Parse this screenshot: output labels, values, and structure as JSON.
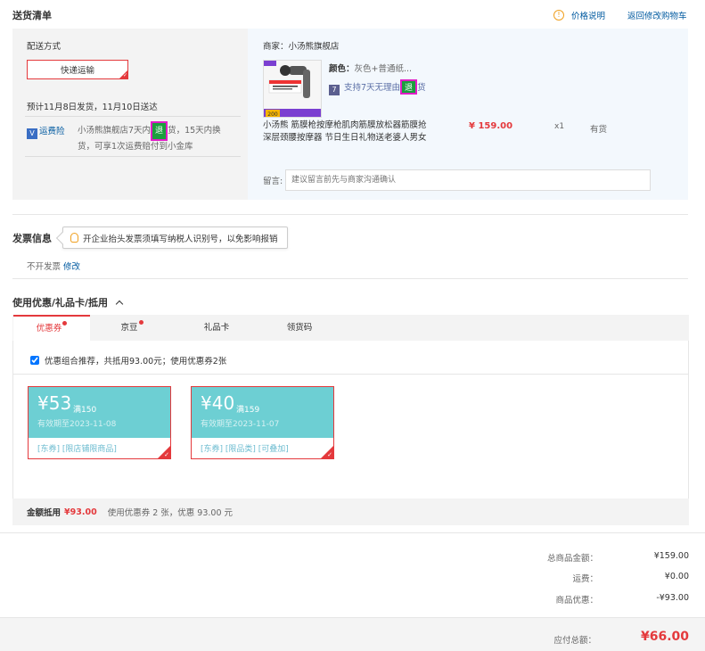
{
  "shipping": {
    "title": "送货清单",
    "price_note": "价格说明",
    "back_cart": "返回修改购物车",
    "method_label": "配送方式",
    "method_value": "快递运输",
    "schedule": "预计11月8日发货，11月10日送达",
    "insurance_label": "运费险",
    "insurance_text_a": "小汤熊旗舰店7天内",
    "return_word": "退",
    "insurance_text_b": "货，15天内换",
    "insurance_text_c": "货，可享1次运费赔付到小金库"
  },
  "product": {
    "merchant": "商家：小汤熊旗舰店",
    "color_label": "颜色：",
    "color_value": "灰色+普通纸...",
    "return_policy_a": "支持7天无理由",
    "return_policy_b": "货",
    "name_line1": "小汤熊 筋膜枪按摩枪肌肉筋膜放松器筋膜抢",
    "name_line2": "深层颈腰按摩器 节日生日礼物送老婆人男女",
    "price": "¥ 159.00",
    "quantity": "x1",
    "stock": "有货",
    "img_badge": "200",
    "remark_label": "留言:",
    "remark_placeholder": "建议留言前先与商家沟通确认"
  },
  "invoice": {
    "title": "发票信息",
    "tip": "开企业抬头发票须填写纳税人识别号，以免影响报销",
    "status": "不开发票",
    "edit": "修改"
  },
  "discount": {
    "title": "使用优惠/礼品卡/抵用",
    "tabs": [
      {
        "label": "优惠券",
        "dot": true
      },
      {
        "label": "京豆",
        "dot": true
      },
      {
        "label": "礼品卡",
        "dot": false
      },
      {
        "label": "领货码",
        "dot": false
      }
    ],
    "combo_text": "优惠组合推荐，共抵用93.00元；使用优惠券2张",
    "coupons": [
      {
        "amount": "¥53",
        "condition": "满150",
        "expiry": "有效期至2023-11-08",
        "tags": "[东券]  [限店铺限商品]"
      },
      {
        "amount": "¥40",
        "condition": "满159",
        "expiry": "有效期至2023-11-07",
        "tags": "[东券]  [限品类]  [可叠加]"
      }
    ],
    "summary_label": "金额抵用",
    "summary_amount": "¥93.00",
    "summary_text": "使用优惠券 2 张，优惠 93.00 元"
  },
  "totals": {
    "goods_label": "总商品金额：",
    "goods_value": "¥159.00",
    "freight_label": "运费：",
    "freight_value": "¥0.00",
    "promo_label": "商品优惠：",
    "promo_value": "-¥93.00",
    "payable_label": "应付总额：",
    "payable_value": "¥66.00"
  },
  "colors": {
    "accent": "#e4393c",
    "coupon": "#6dcfd3",
    "link": "#005aa0"
  }
}
